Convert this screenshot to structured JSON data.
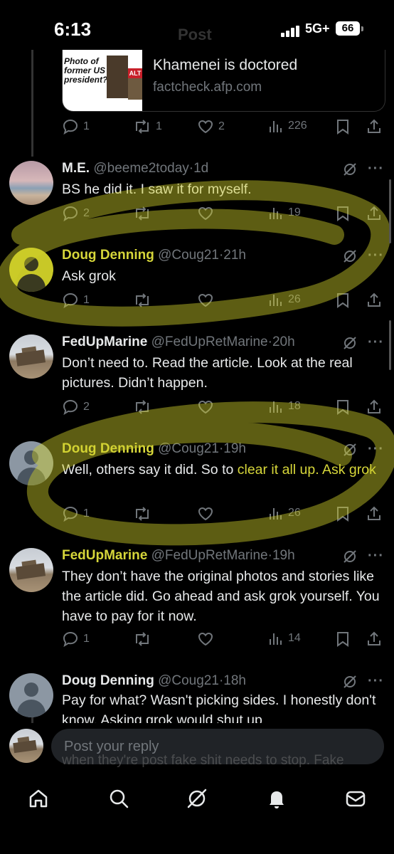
{
  "status": {
    "time": "6:13",
    "network": "5G+",
    "battery": "66",
    "ghost_title": "Post"
  },
  "link_card": {
    "thumb_text": "Photo of former US president?",
    "thumb_badge": "ALT",
    "title": "Khamenei is doctored",
    "domain": "factcheck.afp.com",
    "actions": {
      "replies": "1",
      "reposts": "1",
      "likes": "2",
      "views": "226"
    }
  },
  "posts": [
    {
      "name": "M.E.",
      "handle": "@beeme2today",
      "time": "1d",
      "text": "BS he did it. I saw it for myself.",
      "replies": "2",
      "reposts": "",
      "likes": "",
      "views": "19"
    },
    {
      "name": "Doug Denning",
      "handle": "@Coug21",
      "time": "21h",
      "text": "Ask grok",
      "replies": "1",
      "reposts": "",
      "likes": "",
      "views": "26"
    },
    {
      "name": "FedUpMarine",
      "handle": "@FedUpRetMarine",
      "time": "20h",
      "text": "Don’t need to. Read the article. Look at the real pictures. Didn’t happen.",
      "replies": "2",
      "reposts": "",
      "likes": "",
      "views": "18"
    },
    {
      "name": "Doug Denning",
      "handle": "@Coug21",
      "time": "19h",
      "text_plain": "Well, others say it did. So to ",
      "text_link": "clear it all up. Ask grok",
      "replies": "1",
      "reposts": "",
      "likes": "",
      "views": "26"
    },
    {
      "name": "FedUpMarine",
      "handle": "@FedUpRetMarine",
      "time": "19h",
      "text": "They don’t have the original photos and stories like the article did. Go ahead and ask grok yourself. You have to pay for it now.",
      "replies": "1",
      "reposts": "",
      "likes": "",
      "views": "14"
    },
    {
      "name": "Doug Denning",
      "handle": "@Coug21",
      "time": "18h",
      "text": "Pay for what? Wasn't picking sides. I honestly don't know. Asking grok would shut up"
    }
  ],
  "partial_text": "when they're post fake shit needs to stop. Fake",
  "reply": {
    "placeholder": "Post your reply"
  },
  "tabs": [
    "home-icon",
    "search-icon",
    "grok-icon",
    "notifications-icon",
    "messages-icon"
  ],
  "colors": {
    "background": "#000000",
    "text": "#e7e9ea",
    "muted": "#71767b",
    "highlight": "#d6d63a"
  }
}
